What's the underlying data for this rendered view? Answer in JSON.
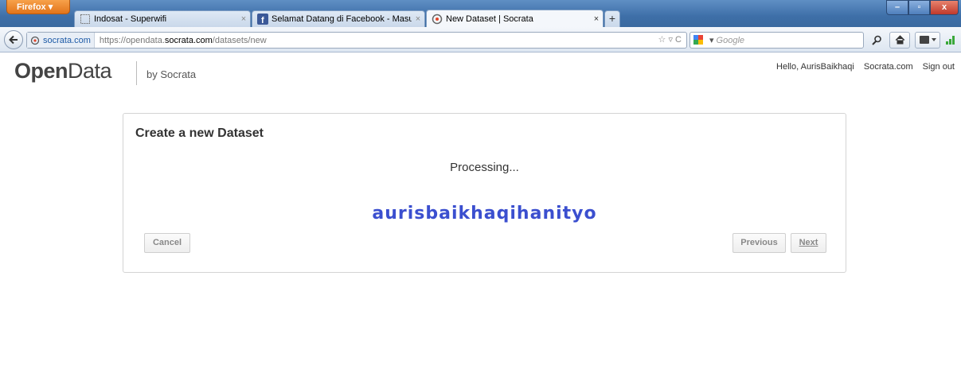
{
  "browser": {
    "menu_button": "Firefox ▾",
    "tabs": [
      {
        "label": "Indosat - Superwifi",
        "close": "×"
      },
      {
        "label": "Selamat Datang di Facebook - Masuk...",
        "close": "×"
      },
      {
        "label": "New Dataset | Socrata",
        "close": "×"
      }
    ],
    "new_tab": "+",
    "window_controls": {
      "minimize": "–",
      "restore": "▫",
      "close": "x"
    },
    "site_identity": "socrata.com",
    "url_prefix": "https://opendata.",
    "url_domain": "socrata.com",
    "url_path": "/datasets/new",
    "url_icons": "☆ ▿ C",
    "search_placeholder": "Google",
    "search_dropdown": "▾"
  },
  "page": {
    "logo_open": "Open",
    "logo_data": "Data",
    "by_socrata": "by Socrata",
    "top_links": [
      "Hello, AurisBaikhaqi",
      "Socrata.com",
      "Sign out"
    ]
  },
  "dialog": {
    "title": "Create a new Dataset",
    "status": "Processing...",
    "watermark": "aurisbaikhaqihanityo",
    "cancel": "Cancel",
    "previous": "Previous",
    "next": "Next"
  }
}
